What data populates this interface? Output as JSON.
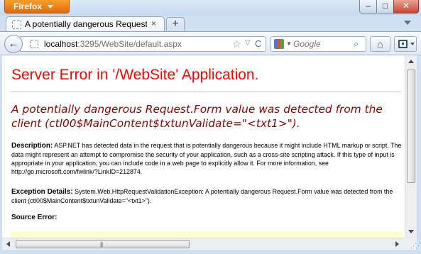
{
  "window": {
    "app_menu_label": "Firefox",
    "minimize_glyph": "‒",
    "maximize_glyph": "□",
    "close_glyph": "✕"
  },
  "tabs": [
    {
      "title": "A potentially dangerous Request.Form v...",
      "close_glyph": "×"
    }
  ],
  "new_tab_glyph": "+",
  "navbar": {
    "back_glyph": "←",
    "url_host": "localhost",
    "url_path": ":3295/WebSite/default.aspx",
    "star_glyph": "☆",
    "dropdown_glyph": "▽",
    "reload_glyph": "C",
    "search_placeholder": "Google",
    "search_glyph": "⌕",
    "home_glyph": "⌂"
  },
  "page": {
    "title": "Server Error in '/WebSite' Application.",
    "error_message": "A potentially dangerous Request.Form value was detected from the client (ctl00$MainContent$txtunValidate=\"<txt1>\").",
    "description_label": "Description:",
    "description_text": "ASP.NET has detected data in the request that is potentially dangerous because it might include HTML markup or script. The data might represent an attempt to compromise the security of your application, such as a cross-site scripting attack. If this type of input is appropriate in your application, you can include code in a web page to explicitly allow it. For more information, see http://go.microsoft.com/fwlink/?LinkID=212874.",
    "exception_label": "Exception Details:",
    "exception_text": "System.Web.HttpRequestValidationException: A potentially dangerous Request.Form value was detected from the client (ctl00$MainContent$txtunValidate=\"<txt1>\").",
    "source_error_label": "Source Error:"
  },
  "scrollbar": {
    "grip_glyph": "|||"
  },
  "colors": {
    "error_title": "#ff0000",
    "error_message": "#8b0000",
    "source_box": "#ffffcc",
    "firefox_button": "#e3690c"
  }
}
